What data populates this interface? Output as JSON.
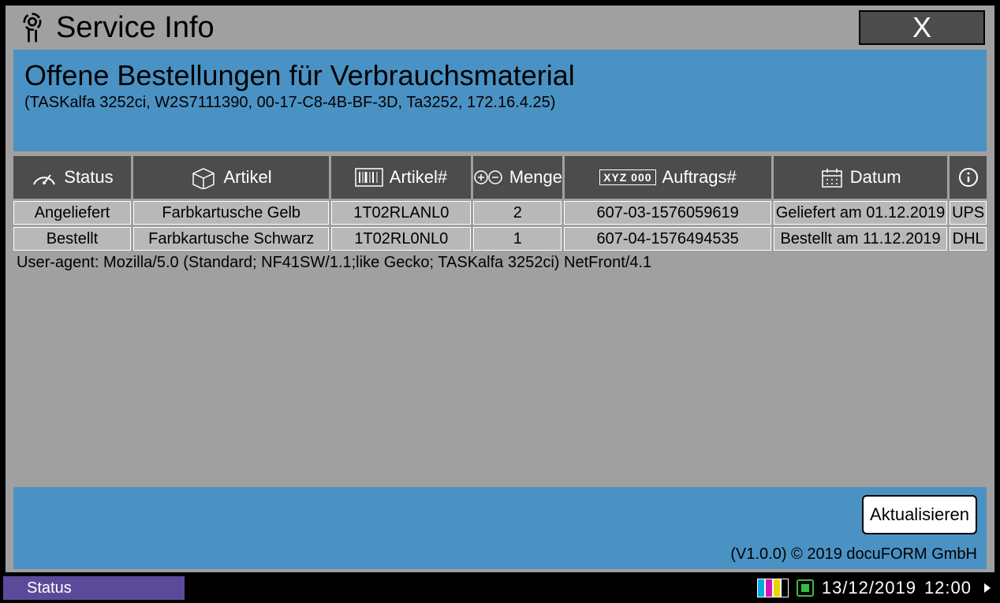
{
  "header": {
    "title": "Service Info",
    "close_label": "X"
  },
  "panel": {
    "heading": "Offene Bestellungen für Verbrauchsmaterial",
    "device_info": "(TASKalfa 3252ci, W2S7111390, 00-17-C8-4B-BF-3D, Ta3252, 172.16.4.25)"
  },
  "table": {
    "headers": {
      "status": "Status",
      "artikel": "Artikel",
      "artikelnr": "Artikel#",
      "menge": "Menge",
      "auftrag": "Auftrags#",
      "datum": "Datum"
    },
    "rows": [
      {
        "status": "Angeliefert",
        "artikel": "Farbkartusche Gelb",
        "artikelnr": "1T02RLANL0",
        "menge": "2",
        "auftrag": "607-03-1576059619",
        "datum": "Geliefert am 01.12.2019",
        "carrier": "UPS"
      },
      {
        "status": "Bestellt",
        "artikel": "Farbkartusche Schwarz",
        "artikelnr": "1T02RL0NL0",
        "menge": "1",
        "auftrag": "607-04-1576494535",
        "datum": "Bestellt am 11.12.2019",
        "carrier": "DHL"
      }
    ]
  },
  "user_agent": "User-agent: Mozilla/5.0 (Standard; NF41SW/1.1;like Gecko; TASKalfa 3252ci) NetFront/4.1",
  "footer": {
    "refresh": "Aktualisieren",
    "copyright": "(V1.0.0) © 2019 docuFORM GmbH"
  },
  "statusbar": {
    "label": "Status",
    "date": "13/12/2019",
    "time": "12:00",
    "toner_colors": [
      "#00aadd",
      "#d516b5",
      "#e7d600",
      "#000000"
    ]
  },
  "icons": {
    "auftrag_text": "XYZ 000"
  }
}
